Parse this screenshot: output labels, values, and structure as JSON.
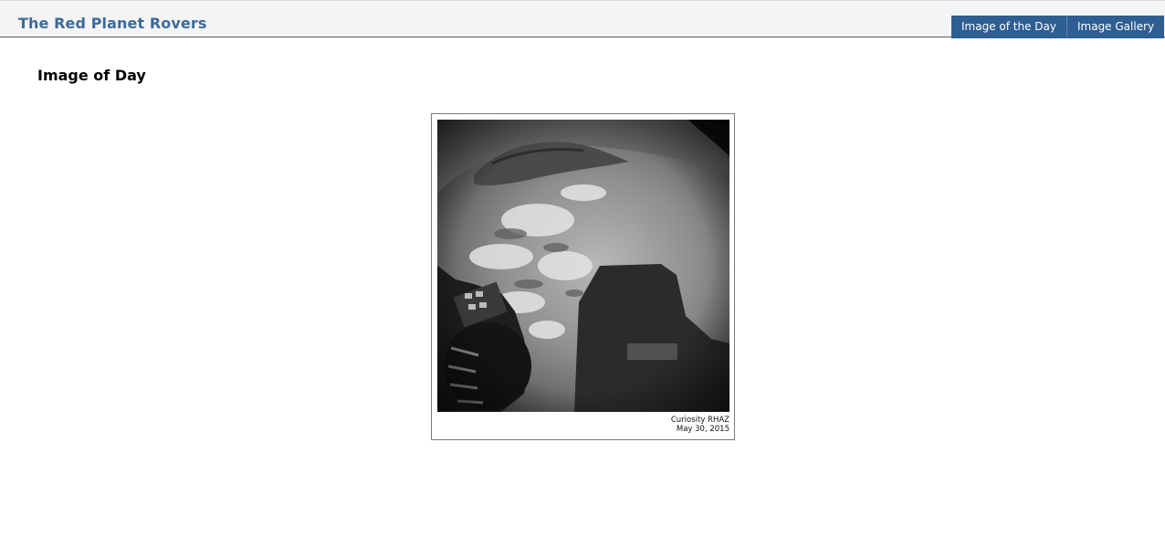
{
  "header": {
    "site_title": "The Red Planet Rovers",
    "nav": [
      {
        "label": "Image of the Day"
      },
      {
        "label": "Image Gallery"
      }
    ]
  },
  "main": {
    "heading": "Image of Day",
    "photo": {
      "icon": "mars-rover-hazcam-photo",
      "caption_line1": "Curiosity RHAZ",
      "caption_line2": "May 30, 2015"
    }
  },
  "colors": {
    "brand": "#3d6a99",
    "nav_bg": "#2f5e92",
    "topbar_bg": "#f4f4f4"
  }
}
